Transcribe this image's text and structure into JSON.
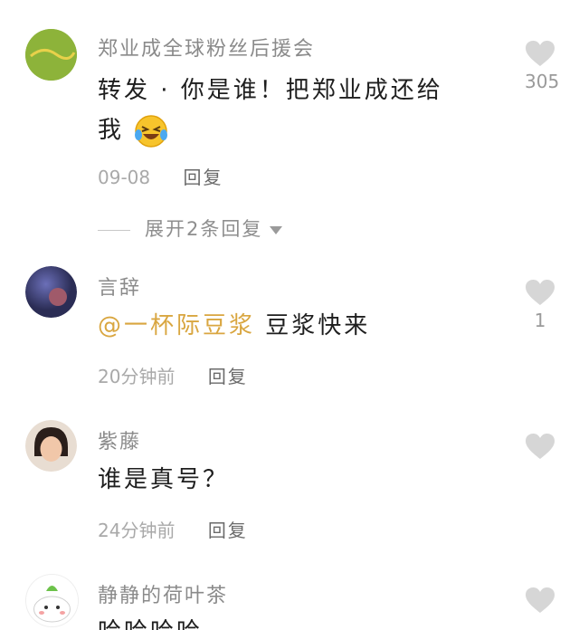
{
  "comments": [
    {
      "username": "郑业成全球粉丝后援会",
      "avatar_text": "郑业成全球粉丝后援会",
      "text_line1": "转发 · 你是谁！把郑业成还给",
      "text_line2": "我",
      "emoji": "laughing-crying-emoji",
      "time": "09-08",
      "reply_label": "回复",
      "likes": "305"
    },
    {
      "username": "言辞",
      "mention": "@一杯际豆浆",
      "text": "豆浆快来",
      "time": "20分钟前",
      "reply_label": "回复",
      "likes": "1"
    },
    {
      "username": "紫藤",
      "text": "谁是真号？",
      "time": "24分钟前",
      "reply_label": "回复",
      "likes": ""
    },
    {
      "username": "静静的荷叶茶",
      "text": "哈哈哈哈",
      "likes": ""
    }
  ],
  "expand_replies": "展开2条回复",
  "colors": {
    "mention": "#d9a640",
    "heart": "#d6d6d6",
    "avatar1_bg": "#8db33a"
  }
}
